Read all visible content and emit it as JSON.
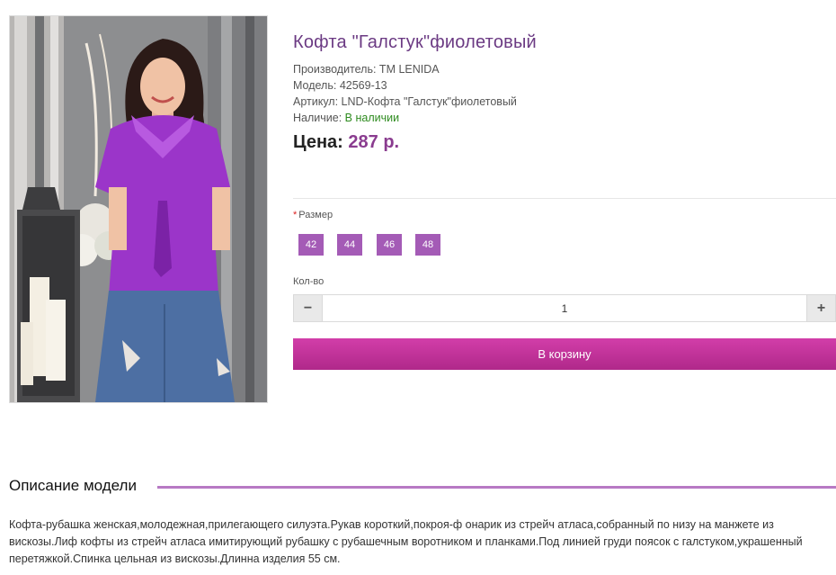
{
  "product": {
    "title": "Кофта \"Галстук\"фиолетовый",
    "manufacturer": "Производитель: TM LENIDA",
    "model": "Модель: 42569-13",
    "article": "Артикул: LND-Кофта \"Галстук\"фиолетовый",
    "availability_label": "Наличие: ",
    "availability_value": "В наличии",
    "price_label": "Цена: ",
    "price_value": "287 р."
  },
  "options": {
    "required_mark": "*",
    "size_label": "Размер",
    "sizes": [
      "42",
      "44",
      "46",
      "48"
    ]
  },
  "quantity": {
    "label": "Кол-во",
    "minus": "−",
    "value": "1",
    "plus": "+"
  },
  "cart": {
    "button_label": "В корзину"
  },
  "description": {
    "title": "Описание модели",
    "text": "Кофта-рубашка женская,молодежная,прилегающего силуэта.Рукав короткий,покроя-ф онарик из стрейч атласа,собранный по низу на манжете из вискозы.Лиф кофты из стрейч атласа имитирующий рубашку с рубашечным воротником и планками.Под линией груди поясок с галстуком,украшенный перетяжкой.Спинка цельная из вискозы.Длинна изделия 55 см."
  },
  "colors": {
    "accent": "#a45bb6",
    "title": "#6b3a83",
    "price": "#8a3c8f",
    "in_stock": "#2e8b1f",
    "cart_button": "#c2339b"
  }
}
